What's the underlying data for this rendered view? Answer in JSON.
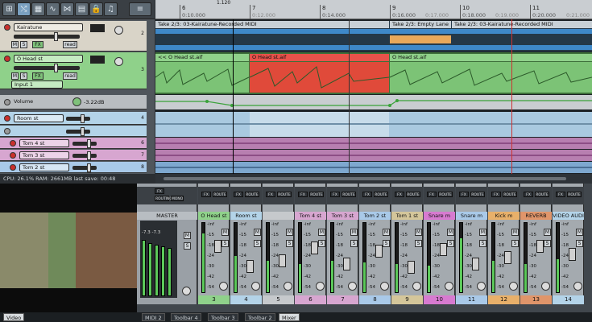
{
  "ruler": {
    "playhead": "1.120",
    "labels": [
      "6",
      "7",
      "8",
      "9",
      "10",
      "11"
    ],
    "times": [
      "0:10.000",
      "0:12.000",
      "0:14.000",
      "0:16.000",
      "0:18.000",
      "0:20.000"
    ],
    "faded": [
      "0:12.000",
      "0:17.000",
      "0:19.000",
      "0:21.000"
    ]
  },
  "tracks": [
    {
      "name": "Kairatune",
      "num": "2",
      "color": "#d9d4c8"
    },
    {
      "name": "O Head st",
      "num": "3",
      "color": "#8fd18a",
      "input": "Input 1"
    },
    {
      "name": "Volume",
      "value": "-3.22dB"
    },
    {
      "name": "Room st",
      "num": "4",
      "color": "#b3d3e8"
    },
    {
      "name": "Tom 4 st",
      "num": "6",
      "color": "#d7a6d0"
    },
    {
      "name": "Tom 3 st",
      "num": "7",
      "color": "#d7a6d0"
    },
    {
      "name": "Tom 2 st",
      "num": "8",
      "color": "#a9c9e8"
    }
  ],
  "tcp": {
    "mute": "M",
    "solo": "S",
    "fx": "FX",
    "mode": "read"
  },
  "items": {
    "midi1": "Take 2/3: 03-Kairatune-Recorded MIDI",
    "empty": "Take 2/3: Empty Lane",
    "midi2": "Take 2/3: 03-Kairatune-Recorded MIDI",
    "audio1": "<< O Head st.aif",
    "audio2": "O Head st.aif",
    "audio3": "O Head st.aif"
  },
  "status": "CPU: 26.1%  RAM: 2661MB  last save: 00:48",
  "mixer": {
    "master": "MASTER",
    "master_btns": {
      "routing": "ROUTING",
      "mono": "MONO"
    },
    "fx": "FX",
    "route": "ROUTE",
    "m": "M",
    "s": "S",
    "ms_db": [
      "-7.3",
      "-7.3"
    ],
    "db_ticks": [
      "-inf",
      "-15",
      "-18",
      "-24",
      "-30",
      "-42",
      "-54"
    ],
    "strips": [
      {
        "name": "O Head st",
        "num": "3",
        "color": "#8fd18a"
      },
      {
        "name": "Room st",
        "num": "4",
        "color": "#b3d3e8"
      },
      {
        "name": "",
        "num": "5",
        "color": "#c6c9cc"
      },
      {
        "name": "Tom 4 st",
        "num": "6",
        "color": "#d7a6d0"
      },
      {
        "name": "Tom 3 st",
        "num": "7",
        "color": "#d7a6d0"
      },
      {
        "name": "Tom 2 st",
        "num": "8",
        "color": "#a9c9e8"
      },
      {
        "name": "Tom 1 st",
        "num": "9",
        "color": "#d4c69a"
      },
      {
        "name": "Snare m",
        "num": "10",
        "color": "#d77ad0"
      },
      {
        "name": "Snare m",
        "num": "11",
        "color": "#a9c9e8"
      },
      {
        "name": "Kick m",
        "num": "12",
        "color": "#e8b06a"
      },
      {
        "name": "REVERB",
        "num": "13",
        "color": "#e0956a"
      },
      {
        "name": "VIDEO AUDI",
        "num": "14",
        "color": "#b3d3e8"
      }
    ]
  },
  "bottom_tabs": [
    "Video",
    "MIDI 2",
    "Toolbar 4",
    "Toolbar 3",
    "Toolbar 2",
    "Mixer"
  ],
  "colors": {
    "accent": "#8fd18a",
    "record": "#c9302c",
    "midi": "#4a9ad8",
    "selection": "#e04a3a"
  }
}
